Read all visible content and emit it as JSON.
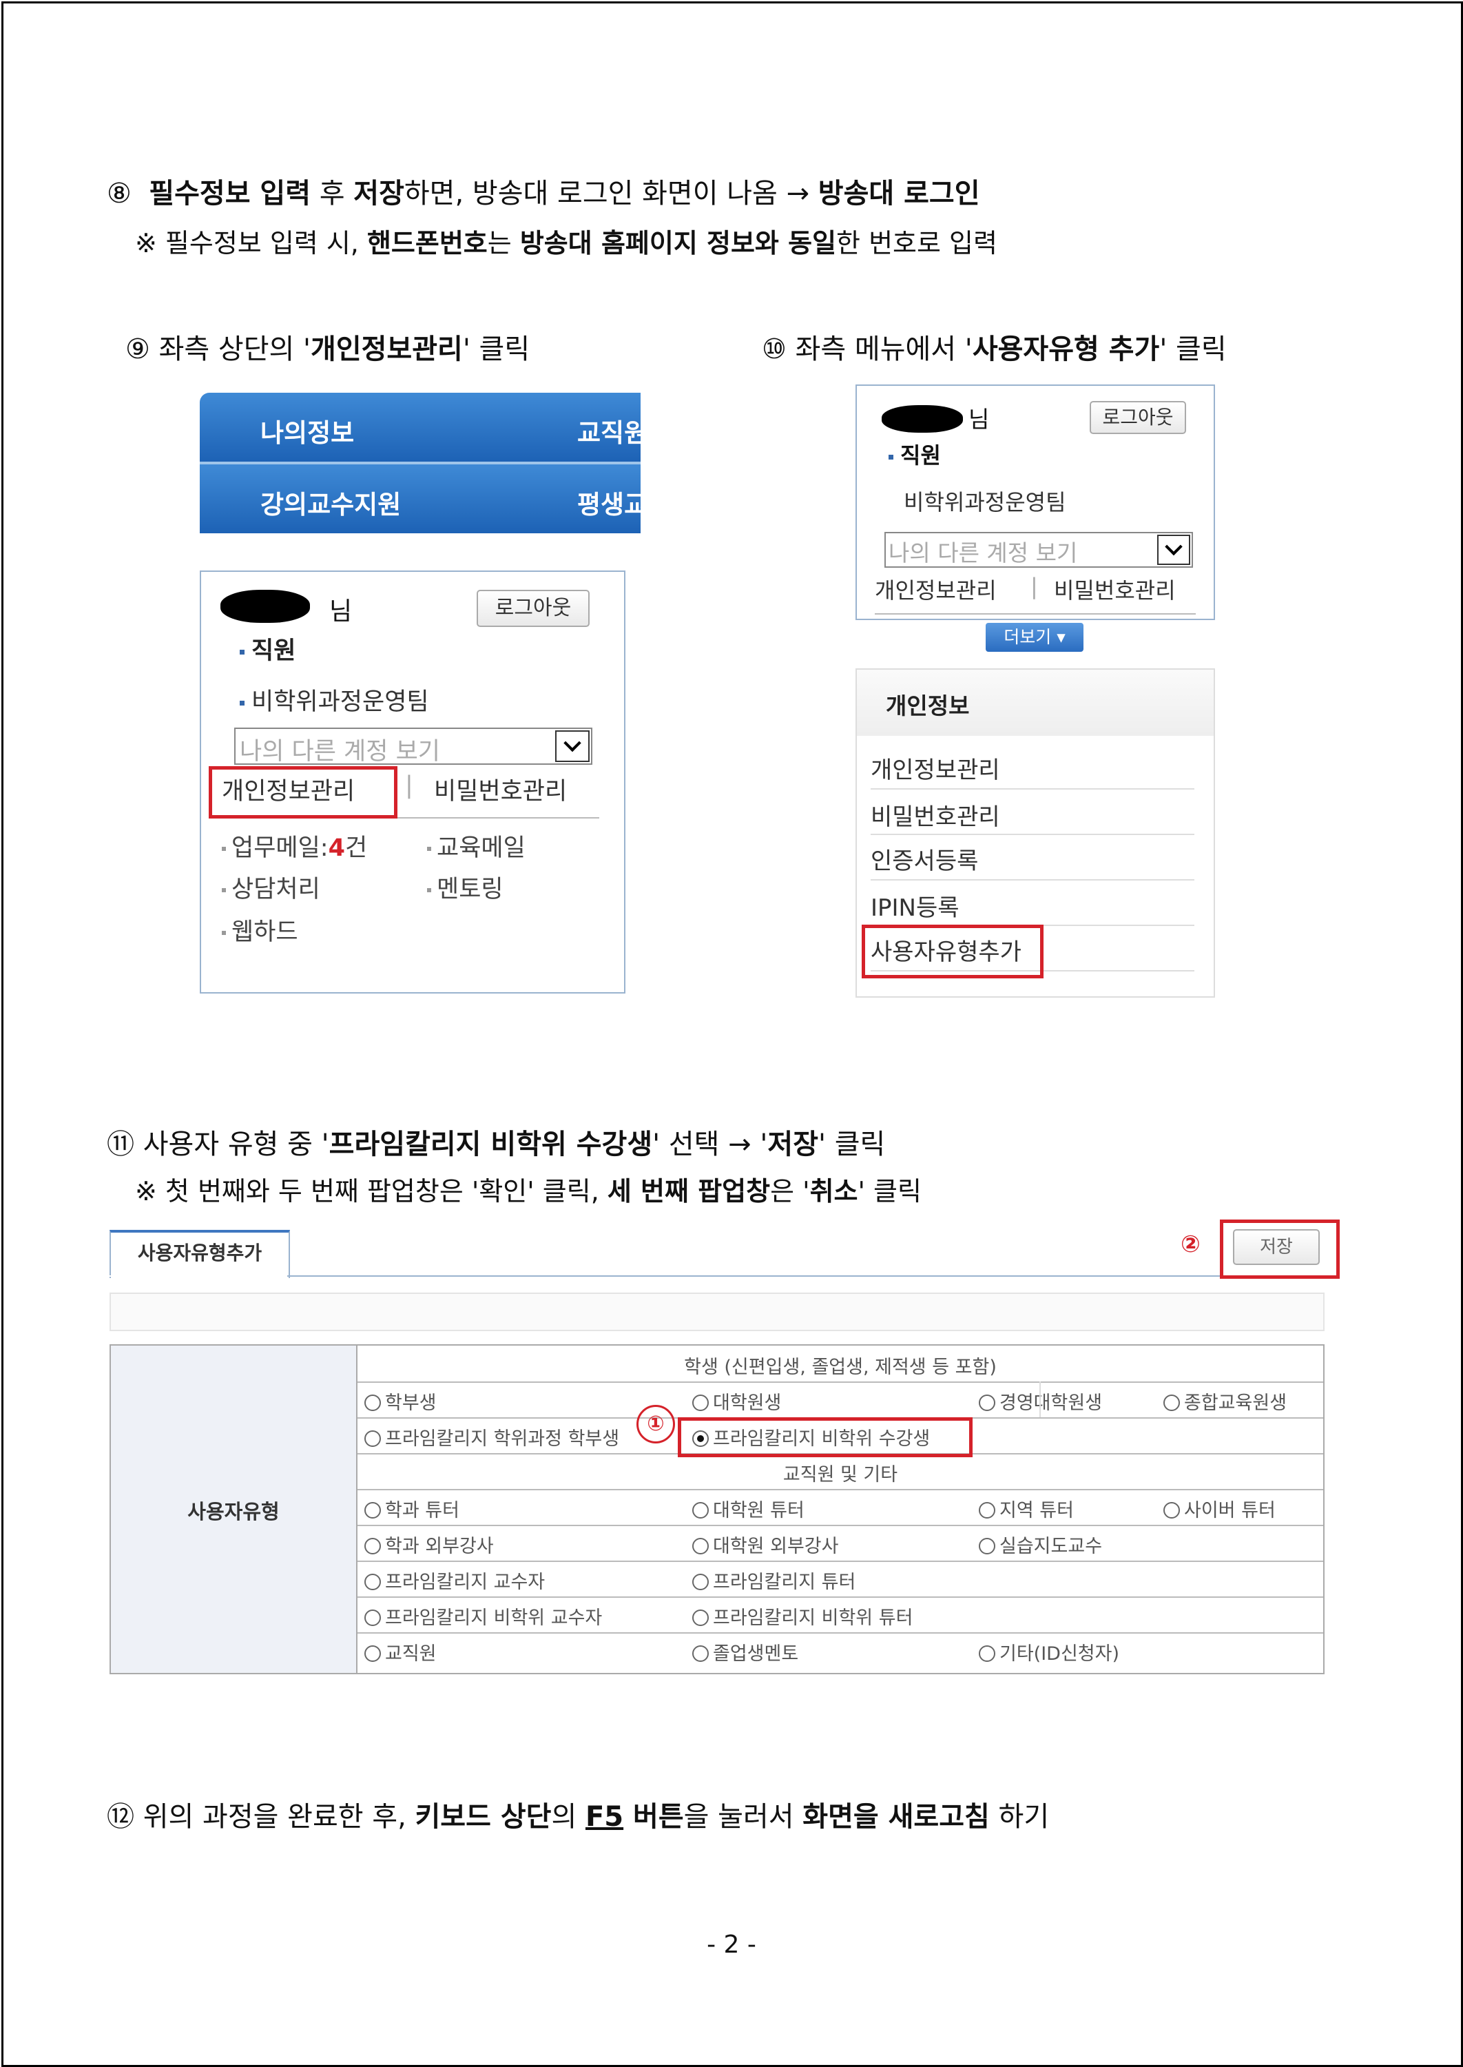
{
  "steps": {
    "s8": {
      "num": "⑧",
      "t1": "필수정보 입력",
      "t2": " 후 ",
      "t3": "저장",
      "t4": "하면, 방송대 로그인 화면이 나옴 → ",
      "t5": "방송대 로그인"
    },
    "s8_note": {
      "t1": "※ 필수정보 입력 시, ",
      "t2": "핸드폰번호",
      "t3": "는 ",
      "t4": "방송대 홈페이지 정보와 동일",
      "t5": "한 번호로 입력"
    },
    "s9": {
      "num": "⑨",
      "t1": "좌측 상단의 '",
      "t2": "개인정보관리",
      "t3": "' 클릭"
    },
    "s10": {
      "num": "⑩",
      "t1": "좌측 메뉴에서 '",
      "t2": "사용자유형 추가",
      "t3": "' 클릭"
    },
    "s11": {
      "num": "⑪",
      "t1": "사용자 유형 중 '",
      "t2": "프라임칼리지 비학위 수강생",
      "t3": "' 선택 → '",
      "t4": "저장",
      "t5": "' 클릭"
    },
    "s11_note": {
      "t1": "※ 첫 번째와 두 번째 팝업창은 '확인' 클릭, ",
      "t2": "세 번째 팝업창",
      "t3": "은 '",
      "t4": "취소",
      "t5": "' 클릭"
    },
    "s12": {
      "num": "⑫",
      "t1": "위의 과정을 완료한 후, ",
      "t2": "키보드 상단",
      "t3": "의 ",
      "t4": "F5",
      "t5": " 버튼",
      "t6": "을 눌러서 ",
      "t7": "화면을 새로고침",
      "t8": " 하기"
    }
  },
  "menu": {
    "tab1": "나의정보",
    "tab2": "교직원",
    "tab3": "강의교수지원",
    "tab4": "평생교"
  },
  "login": {
    "nim": "님",
    "logout": "로그아웃",
    "role": "직원",
    "team": "비학위과정운영팀",
    "account_select": "나의 다른 계정 보기",
    "privacy": "개인정보관리",
    "divider": "|",
    "password": "비밀번호관리",
    "work_mail_label": "업무메일:",
    "work_mail_count": "4",
    "work_mail_unit": "건",
    "edu_mail": "교육메일",
    "counsel": "상담처리",
    "mentoring": "멘토링",
    "webhard": "웹하드",
    "more": "더보기 ▾"
  },
  "side_menu": {
    "title": "개인정보",
    "items": [
      "개인정보관리",
      "비밀번호관리",
      "인증서등록",
      "IPIN등록",
      "사용자유형추가"
    ]
  },
  "form": {
    "tab": "사용자유형추가",
    "save": "저장",
    "marker1": "①",
    "marker2": "②",
    "label": "사용자유형",
    "student_header": "학생 (신편입생, 졸업생, 제적생 등 포함)",
    "staff_header": "교직원 및 기타",
    "r1": [
      "학부생",
      "대학원생",
      "경영대학원생",
      "종합교육원생"
    ],
    "r2": [
      "프라임칼리지 학위과정 학부생",
      "프라임칼리지 비학위 수강생"
    ],
    "r3": [
      "학과 튜터",
      "대학원 튜터",
      "지역 튜터",
      "사이버 튜터"
    ],
    "r4": [
      "학과 외부강사",
      "대학원 외부강사",
      "실습지도교수"
    ],
    "r5": [
      "프라임칼리지 교수자",
      "프라임칼리지 튜터"
    ],
    "r6": [
      "프라임칼리지 비학위 교수자",
      "프라임칼리지 비학위 튜터"
    ],
    "r7": [
      "교직원",
      "졸업생멘토",
      "기타(ID신청자)"
    ]
  },
  "page_number": "- 2 -"
}
